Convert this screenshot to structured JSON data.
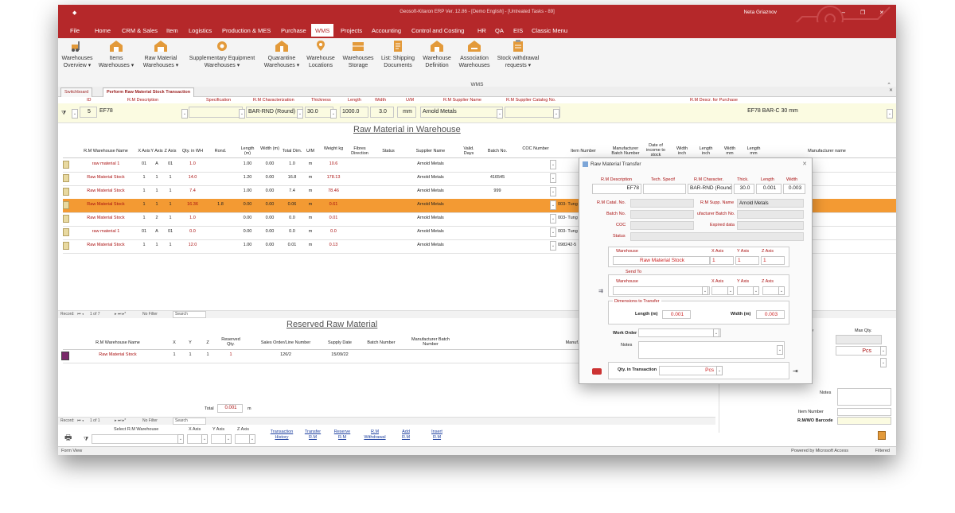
{
  "window": {
    "title": "Geosoft-Kitaron ERP Ver. 12.86 - [Demo English] - [Untreated Tasks - 89]",
    "user": "Neta Griaznov",
    "min": "–",
    "max": "❐",
    "close": "✕"
  },
  "menu": [
    "File",
    "Home",
    "CRM & Sales",
    "Item",
    "Logistics",
    "Production & MES",
    "Purchase",
    "WMS",
    "Projects",
    "Accounting",
    "Control and Costing",
    "HR",
    "QA",
    "EIS",
    "Classic Menu"
  ],
  "ribbon": {
    "group": "WMS",
    "buttons": [
      {
        "line1": "Warehouses",
        "line2": "Overview ▾"
      },
      {
        "line1": "Items",
        "line2": "Warehouses ▾"
      },
      {
        "line1": "Raw Material",
        "line2": "Warehouses ▾"
      },
      {
        "line1": "Supplementary Equipment",
        "line2": "Warehouses ▾"
      },
      {
        "line1": "Quarantine",
        "line2": "Warehouses ▾"
      },
      {
        "line1": "Warehouse",
        "line2": "Locations"
      },
      {
        "line1": "Warehouses",
        "line2": "Storage"
      },
      {
        "line1": "List: Shipping",
        "line2": "Documents"
      },
      {
        "line1": "Warehouse",
        "line2": "Definition"
      },
      {
        "line1": "Association",
        "line2": "Warehouses"
      },
      {
        "line1": "Stock withdrawal",
        "line2": "requests ▾"
      }
    ]
  },
  "tabs": [
    "Switchboard",
    "Perform Raw Material Stock Transaction"
  ],
  "header": {
    "labels": {
      "id": "ID",
      "desc": "R.M Description",
      "spec": "Specification",
      "char": "R.M Characterization",
      "thick": "Thickness",
      "length": "Length",
      "width": "Width",
      "um": "U/M",
      "supp": "R.M Supplier Name",
      "cat": "R.M Supplier Catalog No.",
      "purch": "R.M Descr. for Purchase"
    },
    "values": {
      "id": "5",
      "desc": "EF78",
      "spec": "",
      "char": "BAR-RND (Round)",
      "thick": "30.0",
      "length": "1000.0",
      "width": "3.0",
      "um": "mm",
      "supp": "Arnold Metals",
      "cat": "",
      "purch": "EF78  BAR-C 30 mm"
    }
  },
  "section1": "Raw Material in Warehouse",
  "grid1": {
    "headers": [
      "R.M Warehouse Name",
      "X Axis",
      "Y Axis",
      "Z Axis",
      "Qty. in WH",
      "Rond.",
      "Length (m)",
      "Width (m)",
      "Total Dim.",
      "U/M",
      "Weight kg",
      "Fibres Direction",
      "Status",
      "Supplier Name",
      "Valid. Days",
      "Batch No.",
      "COC Number",
      "Item Number",
      "Manufacturer Batch Number",
      "Date of income to stock",
      "Width inch",
      "Length inch",
      "Width mm",
      "Length mm",
      "Manufacturer name"
    ],
    "rows": [
      [
        "raw material 1",
        "01",
        "A",
        "01",
        "1.0",
        "",
        "1.00",
        "0.00",
        "1.0",
        "m",
        "10.6",
        "",
        "",
        "Arnold Metals",
        "",
        "",
        "",
        "",
        "",
        "",
        "",
        "",
        "",
        "",
        ""
      ],
      [
        "Raw Material Stock",
        "1",
        "1",
        "1",
        "14.0",
        "",
        "1.20",
        "0.00",
        "16.8",
        "m",
        "178.13",
        "",
        "",
        "Arnold Metals",
        "",
        "416545",
        "",
        "",
        "",
        "",
        "",
        "",
        "",
        "",
        ""
      ],
      [
        "Raw Material Stock",
        "1",
        "1",
        "1",
        "7.4",
        "",
        "1.00",
        "0.00",
        "7.4",
        "m",
        "78.46",
        "",
        "",
        "Arnold Metals",
        "",
        "999",
        "",
        "",
        "",
        "",
        "",
        "",
        "",
        "",
        ""
      ],
      [
        "Raw Material Stock",
        "1",
        "1",
        "1",
        "16.36",
        "1.8",
        "0.00",
        "0.00",
        "0.06",
        "m",
        "0.61",
        "",
        "",
        "Arnold Metals",
        "",
        "",
        "",
        "003- Tung",
        "",
        "",
        "",
        "",
        "",
        "",
        ""
      ],
      [
        "Raw Material Stock",
        "1",
        "2",
        "1",
        "1.0",
        "",
        "0.00",
        "0.00",
        "0.0",
        "m",
        "0.01",
        "",
        "",
        "Arnold Metals",
        "",
        "",
        "",
        "003- Tung",
        "",
        "",
        "",
        "",
        "",
        "",
        ""
      ],
      [
        "raw material 1",
        "01",
        "A",
        "01",
        "0.0",
        "",
        "0.00",
        "0.00",
        "0.0",
        "m",
        "0.0",
        "",
        "",
        "Arnold Metals",
        "",
        "",
        "",
        "003- Tung",
        "",
        "",
        "",
        "",
        "",
        "",
        ""
      ],
      [
        "Raw Material Stock",
        "1",
        "1",
        "1",
        "12.0",
        "",
        "1.00",
        "0.00",
        "0.01",
        "m",
        "0.13",
        "",
        "",
        "Arnold Metals",
        "",
        "",
        "",
        "098242-5",
        "",
        "",
        "",
        "",
        "",
        "",
        ""
      ]
    ],
    "nav": {
      "record": "Record:",
      "pos": "1 of 7",
      "filter": "No Filter",
      "search": "Search"
    }
  },
  "section2": "Reserved Raw Material",
  "grid2": {
    "headers": [
      "R.M Warehouse Name",
      "X",
      "Y",
      "Z",
      "Reserved Qty.",
      "Sales Order/Line Number",
      "Supply Date",
      "Batch Number",
      "Manufacturer Batch Number",
      "Manuf."
    ],
    "rows": [
      [
        "Raw Material Stock",
        "1",
        "1",
        "1",
        "1",
        "126/2",
        "15/09/22",
        "",
        "",
        ""
      ]
    ],
    "total_label": "Total",
    "total_value": "0.001",
    "total_um": "m",
    "nav": {
      "record": "Record:",
      "pos": "1 of 1",
      "filter": "No Filter",
      "search": "Search"
    }
  },
  "right_panel": {
    "qty_label": "ty",
    "max_label": "Max Qty.",
    "um": "Pcs",
    "notes": "Notes",
    "item_number": "Item Number",
    "barcode": "R.M/WO Barcode"
  },
  "bottom": {
    "labels": {
      "select": "Select R.M Warehouse",
      "x": "X Axis",
      "y": "Y Axis",
      "z": "Z Axis"
    },
    "links": [
      {
        "l1": "Transaction",
        "l2": "History"
      },
      {
        "l1": "Transfer",
        "l2": "R.M"
      },
      {
        "l1": "Reserve",
        "l2": "R.M"
      },
      {
        "l1": "R.M",
        "l2": "Withdrawal"
      },
      {
        "l1": "Add",
        "l2": "R.M"
      },
      {
        "l1": "Insert",
        "l2": "R.M"
      }
    ]
  },
  "dialog": {
    "title": "Raw Material Transfer",
    "close": "✕",
    "h": {
      "desc": "R.M Description",
      "tech": "Tech. Specif",
      "char": "R.M Character.",
      "thick": "Thick.",
      "length": "Length",
      "width": "Width"
    },
    "v": {
      "desc": "EF78",
      "tech": "",
      "char": "BAR-RND (Round)",
      "thick": "30.0",
      "length": "0.001",
      "width": "0.003"
    },
    "catal_label": "R.M Catal. No.",
    "supp_label": "R.M Supp. Name",
    "supp_value": "Arnold Metals",
    "batch_label": "Batch No.",
    "mbatch_label": "ufacturer Batch No.",
    "coc_label": "COC",
    "exp_label": "Expired data",
    "status_label": "Status",
    "wh": {
      "label": "Warehouse",
      "x": "X Axis",
      "y": "Y Axis",
      "z": "Z Axis",
      "value": "Raw Material Stock",
      "xv": "1",
      "yv": "1",
      "zv": "1"
    },
    "send": {
      "label": "Send To",
      "wh": "Warehouse",
      "x": "X Axis",
      "y": "Y Axis",
      "z": "Z Axis"
    },
    "dims": {
      "label": "Dimensions to Transfer",
      "length_label": "Length (m)",
      "length": "0.001",
      "width_label": "Width (m)",
      "width": "0.003"
    },
    "work_order": "Work Order",
    "notes": "Notes",
    "qty_label": "Qty. in Transaction",
    "qty_um": "Pcs"
  },
  "status": {
    "left": "Form View",
    "right": "Powered by Microsoft Access",
    "filtered": "Filtered"
  }
}
